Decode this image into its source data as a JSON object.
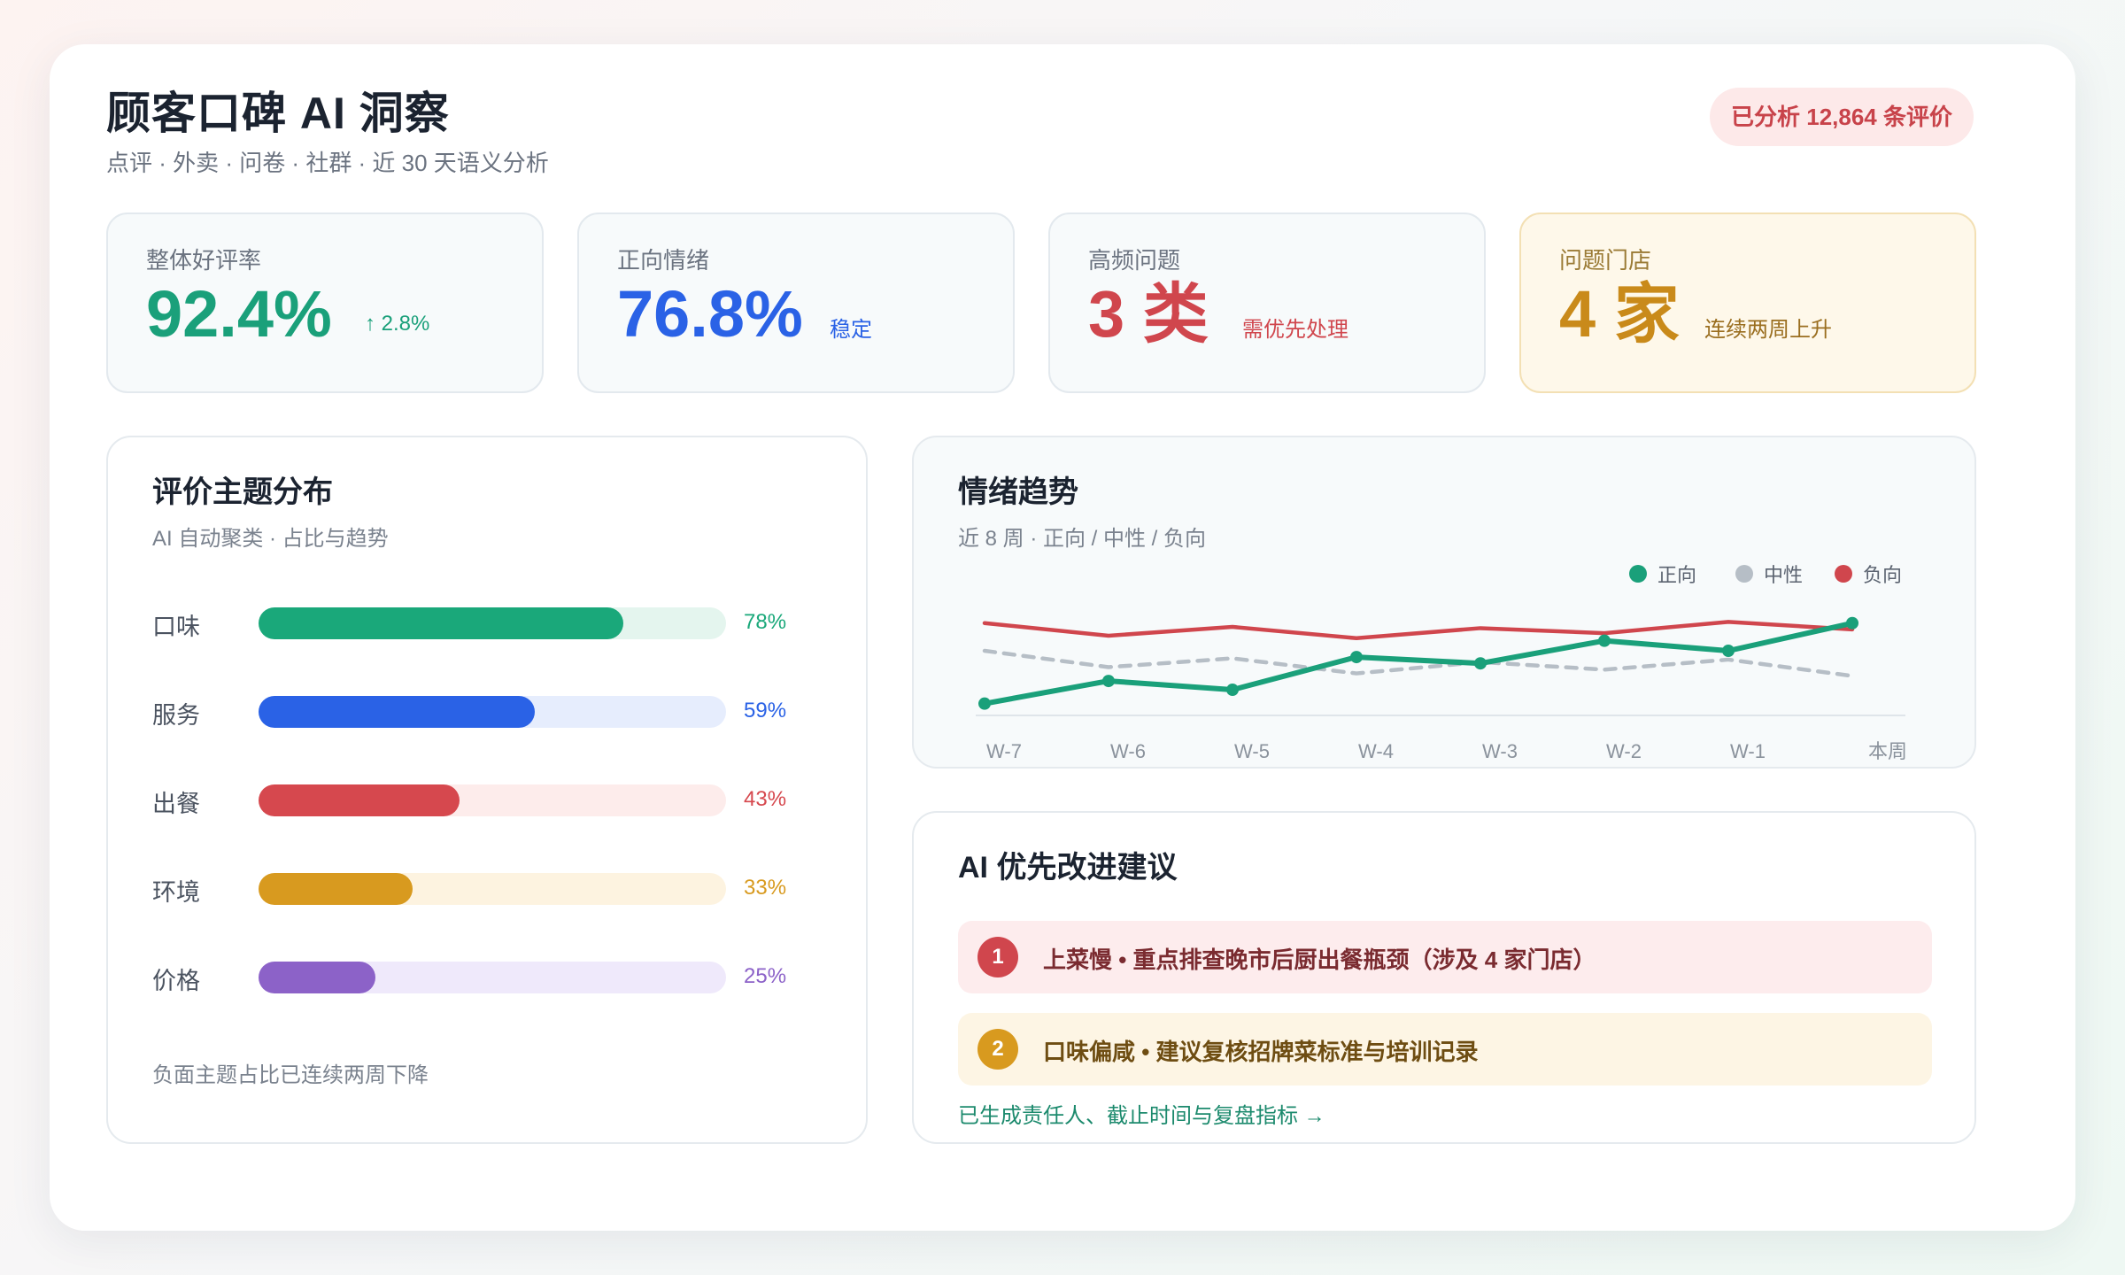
{
  "header": {
    "title": "顾客口碑 AI 洞察",
    "subtitle": "点评 · 外卖 · 问卷 · 社群 · 近 30 天语义分析",
    "badge": "已分析 12,864 条评价"
  },
  "kpis": [
    {
      "label": "整体好评率",
      "value": "92.4%",
      "note": "↑ 2.8%",
      "color": "#1aa07a"
    },
    {
      "label": "正向情绪",
      "value": "76.8%",
      "note": "稳定",
      "color": "#2a62e6"
    },
    {
      "label": "高频问题",
      "value": "3 类",
      "note": "需优先处理",
      "color": "#d0464d"
    },
    {
      "label": "问题门店",
      "value": "4 家",
      "note": "连续两周上升",
      "color": "#c98a1a"
    }
  ],
  "topics": {
    "title": "评价主题分布",
    "subtitle": "AI 自动聚类 · 占比与趋势",
    "items": [
      {
        "label": "口味",
        "percent": 78,
        "pct_text": "78%",
        "color": "#1aa87a",
        "track": "#e4f5ee"
      },
      {
        "label": "服务",
        "percent": 59,
        "pct_text": "59%",
        "color": "#2a62e6",
        "track": "#e6edfd"
      },
      {
        "label": "出餐",
        "percent": 43,
        "pct_text": "43%",
        "color": "#d6484e",
        "track": "#fdeceb"
      },
      {
        "label": "环境",
        "percent": 33,
        "pct_text": "33%",
        "color": "#d89a1f",
        "track": "#fdf3e0"
      },
      {
        "label": "价格",
        "percent": 25,
        "pct_text": "25%",
        "color": "#8c62c8",
        "track": "#efe9fb"
      }
    ],
    "footnote": "负面主题占比已连续两周下降"
  },
  "trend": {
    "title": "情绪趋势",
    "subtitle": "近 8 周 · 正向 / 中性 / 负向",
    "legend": [
      {
        "name": "正向",
        "color": "#1aa07a"
      },
      {
        "name": "中性",
        "color": "#b6bec6"
      },
      {
        "name": "负向",
        "color": "#d0464d"
      }
    ]
  },
  "chart_data": {
    "type": "line",
    "x": [
      "W-7",
      "W-6",
      "W-5",
      "W-4",
      "W-3",
      "W-2",
      "W-1",
      "本周"
    ],
    "series": [
      {
        "name": "正向",
        "values": [
          8,
          26,
          19,
          45,
          40,
          58,
          50,
          72
        ]
      },
      {
        "name": "中性",
        "values": [
          50,
          37,
          44,
          32,
          41,
          35,
          43,
          30
        ]
      },
      {
        "name": "负向",
        "values": [
          72,
          62,
          69,
          60,
          68,
          64,
          73,
          67
        ]
      }
    ],
    "ylim": [
      0,
      100
    ],
    "grid": false,
    "legend": "top-right",
    "colors": {
      "正向": "#1aa07a",
      "中性": "#b6bec6",
      "负向": "#d0464d"
    }
  },
  "recommendations": {
    "title": "AI 优先改进建议",
    "items": [
      {
        "num": "1",
        "text": "上菜慢 • 重点排查晚市后厨出餐瓶颈（涉及 4 家门店）"
      },
      {
        "num": "2",
        "text": "口味偏咸 • 建议复核招牌菜标准与培训记录"
      }
    ],
    "link": "已生成责任人、截止时间与复盘指标 →"
  }
}
